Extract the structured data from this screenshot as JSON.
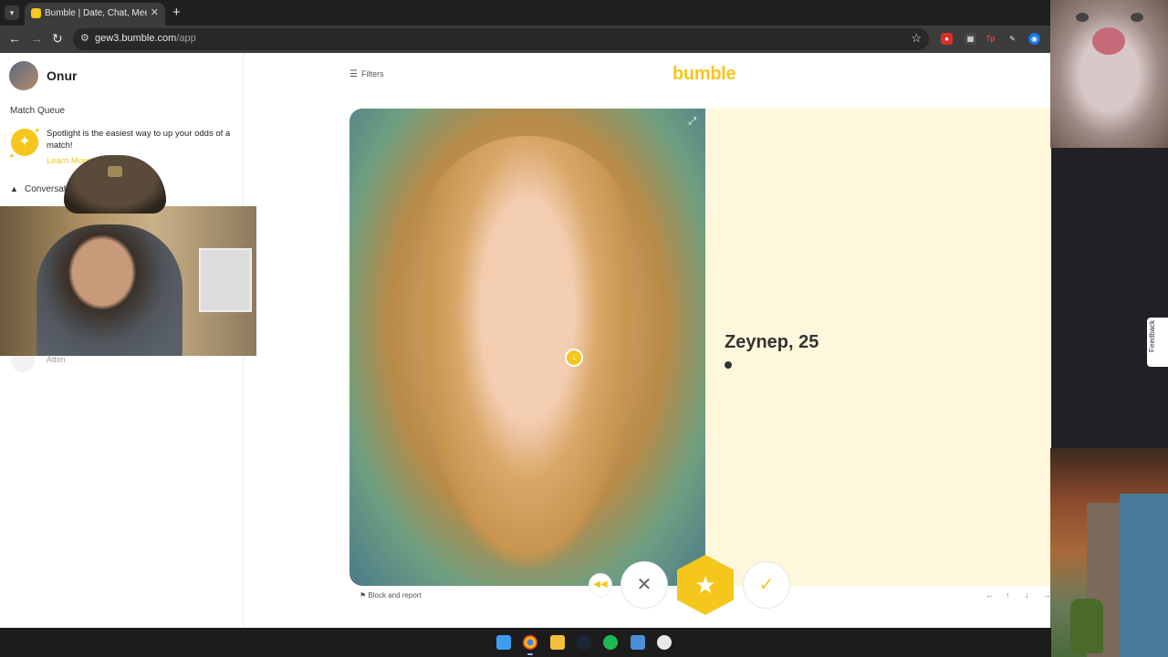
{
  "browser": {
    "tab_title": "Bumble | Date, Chat, Meet New",
    "url_host": "gew3.bumble.com",
    "url_path": "/app"
  },
  "sidebar": {
    "user_name": "Onur",
    "match_queue_title": "Match Queue",
    "spotlight_text": "Spotlight is the easiest way to up your odds of a match!",
    "learn_more": "Learn More",
    "conversations_title": "Conversations",
    "conversation_name": "Attim"
  },
  "main": {
    "filters_label": "Filters",
    "logo": "bumble",
    "profile_name": "Zeynep, 25",
    "block_report": "Block and report",
    "keyboard_hints": [
      "←",
      "↑",
      "↓",
      "→"
    ],
    "feedback_label": "Feedback"
  },
  "icons": {
    "rewind": "rewind-icon",
    "pass": "close-icon",
    "superswipe": "star-icon",
    "like": "check-icon"
  },
  "colors": {
    "brand": "#f5c61c",
    "info_panel": "#fef7dc"
  }
}
